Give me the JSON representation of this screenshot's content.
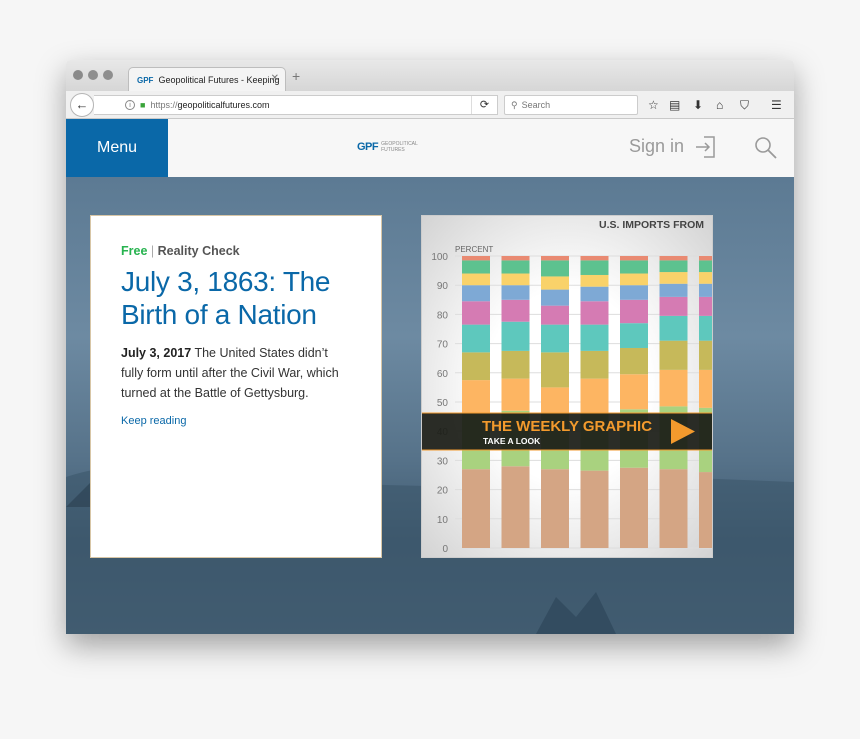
{
  "browser": {
    "tab_title": "Geopolitical Futures - Keeping",
    "tab_favicon": "GPF",
    "url_scheme": "https://",
    "url_host": "geopoliticalfutures.com",
    "search_placeholder": "Search",
    "icons": [
      "back-icon",
      "info-icon",
      "lock-icon",
      "reload-icon",
      "search-icon",
      "star-icon",
      "reading-list-icon",
      "download-icon",
      "home-icon",
      "pocket-icon",
      "hamburger-menu-icon"
    ]
  },
  "site": {
    "menu_label": "Menu",
    "logo_mark": "GPF",
    "logo_text_1": "GEOPOLITICAL",
    "logo_text_2": "FUTURES",
    "sign_in": "Sign in",
    "brand_color": "#0a68a8"
  },
  "article": {
    "tag_free": "Free",
    "tag_sep": "|",
    "tag_category": "Reality Check",
    "title": "July 3, 1863: The Birth of a Nation",
    "date": "July 3, 2017",
    "excerpt": "The United States didn’t fully form until after the Civil War, which turned at the Battle of Gettysburg.",
    "link": "Keep reading"
  },
  "weekly_graphic": {
    "banner_title": "THE WEEKLY GRAPHIC",
    "banner_sub": "TAKE A LOOK",
    "chart_data": {
      "type": "bar",
      "stacked": true,
      "title": "U.S. IMPORTS FROM",
      "ylabel": "PERCENT",
      "ylim": [
        0,
        100
      ],
      "yticks": [
        0,
        10,
        20,
        30,
        40,
        50,
        60,
        70,
        80,
        90,
        100
      ],
      "segment_colors": [
        "#d4a584",
        "#a9d27f",
        "#fdb562",
        "#c6b95a",
        "#5ec8bd",
        "#d57bb3",
        "#7ea9d5",
        "#f9d26a",
        "#5dc28f",
        "#e98a72"
      ],
      "cumulative_tops": [
        [
          27,
          46,
          57.5,
          67,
          76.5,
          84.5,
          90,
          94,
          98.5,
          100
        ],
        [
          28,
          47,
          58,
          67.5,
          77.5,
          85,
          90,
          94,
          98.5,
          100
        ],
        [
          27,
          46,
          55,
          67,
          76.5,
          83,
          88.5,
          93,
          98.5,
          100
        ],
        [
          26.5,
          46,
          58,
          67.5,
          76.5,
          84.5,
          89.5,
          93.5,
          98.5,
          100
        ],
        [
          27.5,
          47.5,
          59.5,
          68.5,
          77,
          85,
          90,
          94,
          98.5,
          100
        ],
        [
          27,
          48.5,
          61,
          71,
          79.5,
          86,
          90.5,
          94.5,
          98.5,
          100
        ],
        [
          26,
          48,
          61,
          71,
          79.5,
          86,
          90.5,
          94.5,
          98.5,
          100
        ]
      ]
    }
  }
}
